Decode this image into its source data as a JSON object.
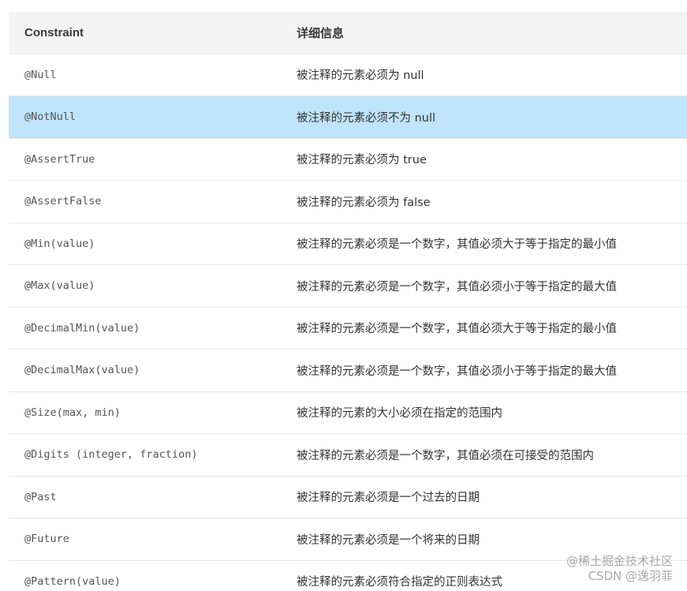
{
  "table": {
    "headers": [
      "Constraint",
      "详细信息"
    ],
    "highlight_color": "#bfe4fb",
    "rows": [
      {
        "constraint": "@Null",
        "detail": "被注释的元素必须为 null",
        "highlighted": false
      },
      {
        "constraint": "@NotNull",
        "detail": "被注释的元素必须不为 null",
        "highlighted": true
      },
      {
        "constraint": "@AssertTrue",
        "detail": "被注释的元素必须为 true",
        "highlighted": false
      },
      {
        "constraint": "@AssertFalse",
        "detail": "被注释的元素必须为 false",
        "highlighted": false
      },
      {
        "constraint": "@Min(value)",
        "detail": "被注释的元素必须是一个数字，其值必须大于等于指定的最小值",
        "highlighted": false
      },
      {
        "constraint": "@Max(value)",
        "detail": "被注释的元素必须是一个数字，其值必须小于等于指定的最大值",
        "highlighted": false
      },
      {
        "constraint": "@DecimalMin(value)",
        "detail": "被注释的元素必须是一个数字，其值必须大于等于指定的最小值",
        "highlighted": false
      },
      {
        "constraint": "@DecimalMax(value)",
        "detail": "被注释的元素必须是一个数字，其值必须小于等于指定的最大值",
        "highlighted": false
      },
      {
        "constraint": "@Size(max, min)",
        "detail": "被注释的元素的大小必须在指定的范围内",
        "highlighted": false
      },
      {
        "constraint": "@Digits (integer, fraction)",
        "detail": "被注释的元素必须是一个数字，其值必须在可接受的范围内",
        "highlighted": false
      },
      {
        "constraint": "@Past",
        "detail": "被注释的元素必须是一个过去的日期",
        "highlighted": false
      },
      {
        "constraint": "@Future",
        "detail": "被注释的元素必须是一个将来的日期",
        "highlighted": false
      },
      {
        "constraint": "@Pattern(value)",
        "detail": "被注释的元素必须符合指定的正则表达式",
        "highlighted": false
      }
    ]
  },
  "watermark": {
    "line1": "@稀土掘金技术社区",
    "line2": "CSDN @逸羽菲"
  }
}
